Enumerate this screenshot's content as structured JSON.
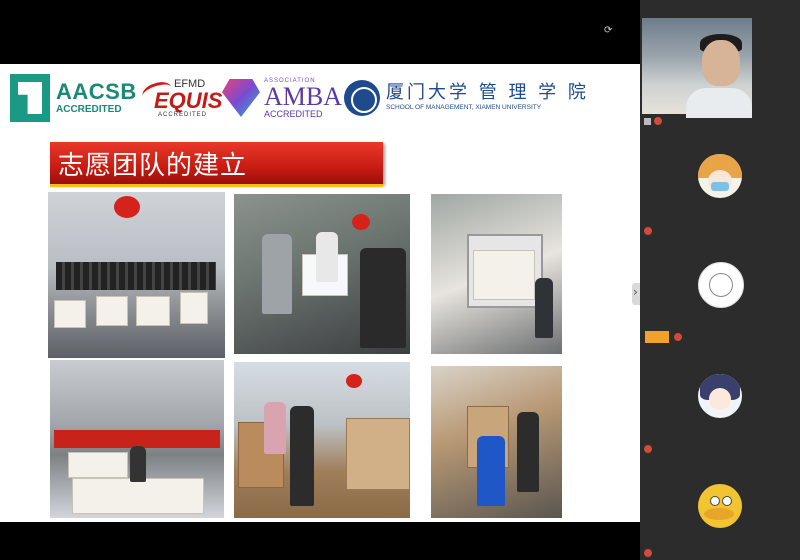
{
  "slide": {
    "title": "志愿团队的建立",
    "logos": {
      "aacsb_main": "AACSB",
      "aacsb_sub": "ACCREDITED",
      "efmd": "EFMD",
      "equis": "EQUIS",
      "equis_sub": "ACCREDITED",
      "amba_assoc": "ASSOCIATION",
      "amba_main": "AMBA",
      "amba_sub": "ACCREDITED",
      "xmu_main": "厦门大学 管 理 学 院",
      "xmu_sub": "SCHOOL OF MANAGEMENT, XIAMEN UNIVERSITY"
    }
  },
  "video_panel": {
    "top_label": "",
    "participants": [
      {
        "name": ""
      },
      {
        "name": ""
      },
      {
        "name": ""
      },
      {
        "name": ""
      },
      {
        "name": ""
      },
      {
        "name": ""
      }
    ],
    "host_badge": ""
  },
  "colors": {
    "title_red": "#c81c14",
    "title_gold": "#f4c020",
    "sidebar_bg": "#2c2c2c",
    "host_orange": "#f3a12a"
  }
}
